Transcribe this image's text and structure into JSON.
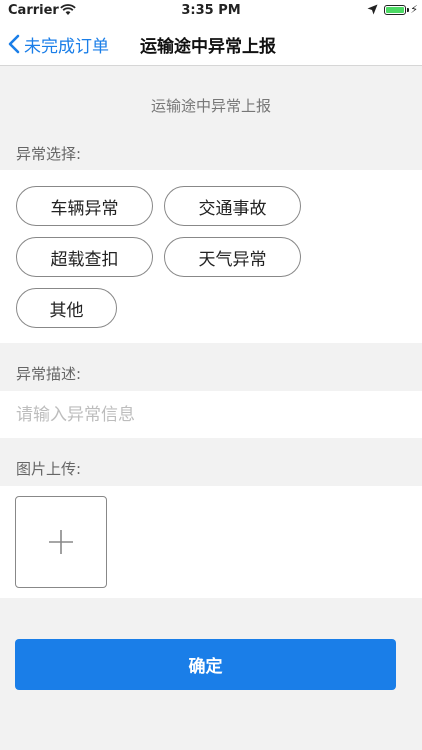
{
  "status_bar": {
    "carrier": "Carrier",
    "time": "3:35 PM"
  },
  "nav": {
    "back_label": "未完成订单",
    "title": "运输途中异常上报"
  },
  "header": {
    "title": "运输途中异常上报"
  },
  "exception_select": {
    "label": "异常选择:",
    "options": [
      "车辆异常",
      "交通事故",
      "超载查扣",
      "天气异常",
      "其他"
    ]
  },
  "exception_desc": {
    "label": "异常描述:",
    "placeholder": "请输入异常信息",
    "value": ""
  },
  "image_upload": {
    "label": "图片上传:"
  },
  "actions": {
    "confirm_label": "确定"
  },
  "colors": {
    "accent": "#1a7ee8",
    "background": "#f2f2f2"
  }
}
